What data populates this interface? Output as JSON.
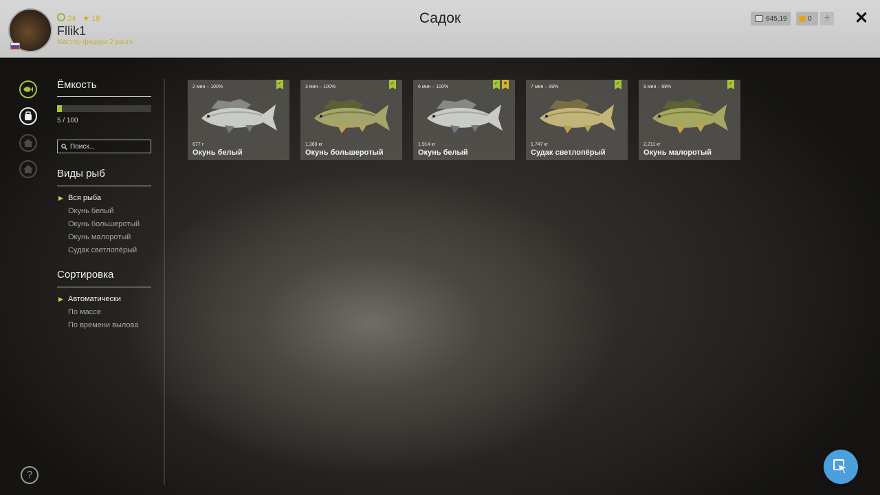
{
  "header": {
    "title": "Садок",
    "user": {
      "name": "Fllik1",
      "level": "24",
      "stars": "18",
      "rank": "Мастер фидера 2 ранга"
    },
    "currency": {
      "silver": "645,19",
      "gold": "0",
      "add_label": "+"
    },
    "close_label": "✕"
  },
  "sidebar": {
    "capacity": {
      "title": "Ёмкость",
      "current": 5,
      "max": 100,
      "text": "5 / 100"
    },
    "search": {
      "placeholder": "Поиск..."
    },
    "species": {
      "title": "Виды рыб",
      "items": [
        "Вся рыба",
        "Окунь белый",
        "Окунь большеротый",
        "Окунь малоротый",
        "Судак светлопёрый"
      ],
      "selected": "Вся рыба"
    },
    "sorting": {
      "title": "Сортировка",
      "items": [
        "Автоматически",
        "По массе",
        "По времени вылова"
      ],
      "selected": "Автоматически"
    },
    "help_label": "?"
  },
  "fish": [
    {
      "time": "2 мин – 100%",
      "weight": "677 г",
      "name": "Окунь белый",
      "badges": [
        "check"
      ]
    },
    {
      "time": "3 мин – 100%",
      "weight": "1,369 кг",
      "name": "Окунь большеротый",
      "badges": [
        "check"
      ]
    },
    {
      "time": "6 мин – 100%",
      "weight": "1,914 кг",
      "name": "Окунь белый",
      "badges": [
        "check",
        "star"
      ]
    },
    {
      "time": "7 мин – 99%",
      "weight": "1,747 кг",
      "name": "Судак светлопёрый",
      "badges": [
        "check"
      ]
    },
    {
      "time": "9 мин – 99%",
      "weight": "2,211 кг",
      "name": "Окунь малоротый",
      "badges": [
        "check"
      ]
    }
  ],
  "colors": {
    "accent": "#a7c33a",
    "star": "#d8b62b",
    "cursor_button": "#4b9fdc"
  },
  "icons": {
    "rail": [
      "fish-icon",
      "bag-icon",
      "home-icon",
      "home-icon"
    ],
    "floating": "cursor-icon"
  }
}
